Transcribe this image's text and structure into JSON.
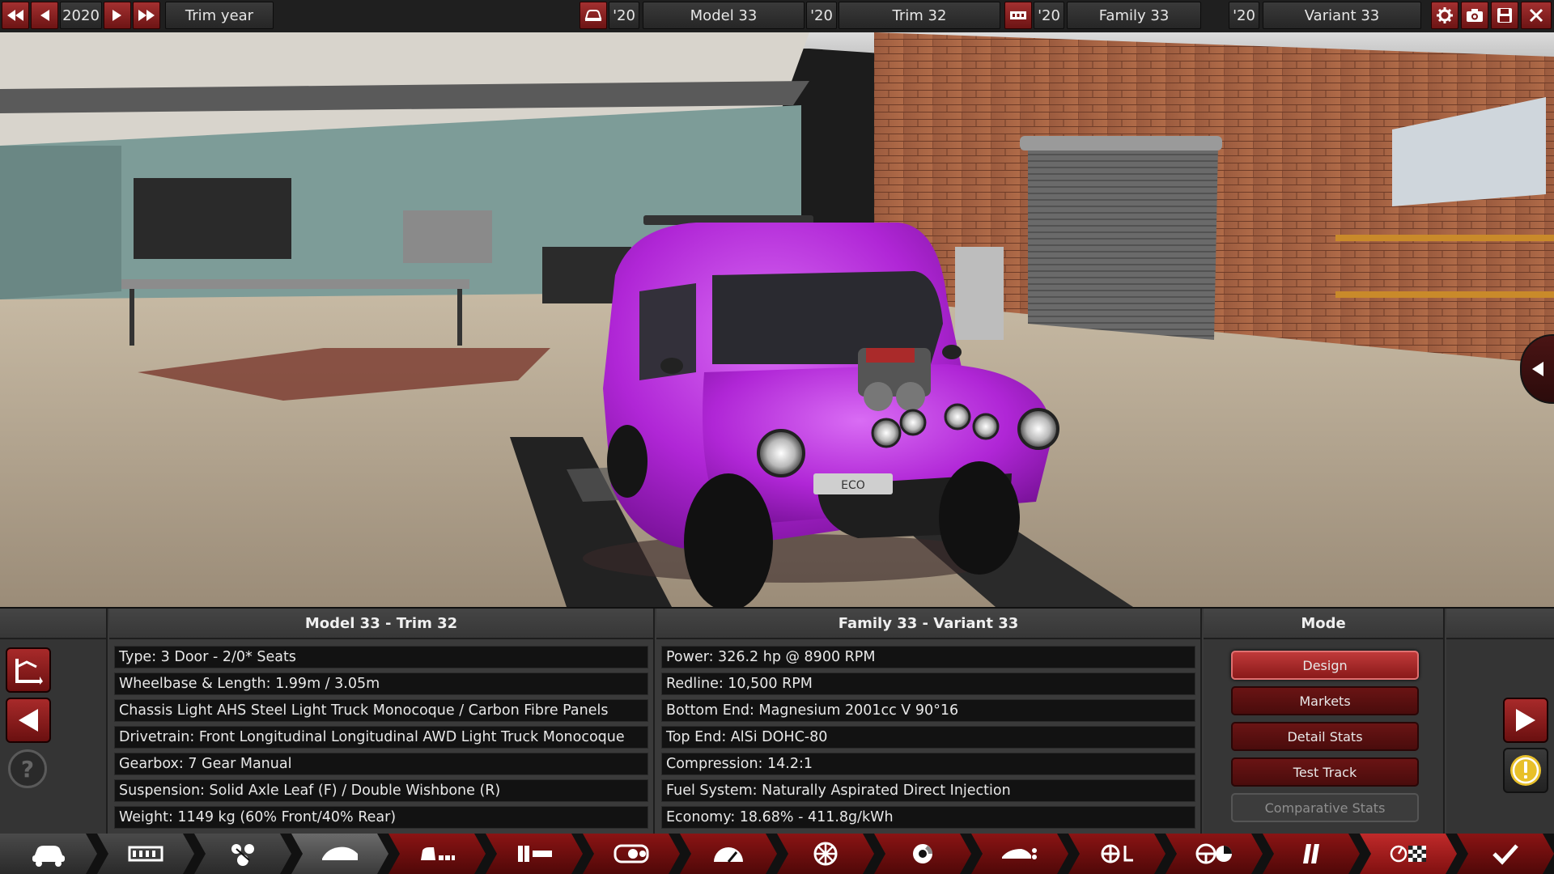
{
  "topbar": {
    "year": "2020",
    "trim_year_label": "Trim year",
    "model_year": "'20",
    "model_name": "Model 33",
    "trim_year": "'20",
    "trim_name": "Trim 32",
    "family_year": "'20",
    "family_name": "Family 33",
    "variant_year": "'20",
    "variant_name": "Variant 33"
  },
  "scene": {
    "plate_text": "ECO"
  },
  "left_panel": {
    "title": "Model 33 - Trim 32",
    "stats": [
      "Type: 3 Door - 2/0* Seats",
      "Wheelbase & Length: 1.99m / 3.05m",
      "Chassis Light AHS Steel Light Truck Monocoque / Carbon Fibre Panels",
      "Drivetrain: Front Longitudinal Longitudinal AWD Light Truck Monocoque",
      "Gearbox: 7 Gear Manual",
      "Suspension: Solid Axle Leaf (F) / Double Wishbone (R)",
      "Weight: 1149 kg (60% Front/40% Rear)"
    ]
  },
  "right_panel": {
    "title": "Family 33 - Variant 33",
    "stats": [
      "Power: 326.2 hp @ 8900 RPM",
      "Redline:  10,500 RPM",
      "Bottom End: Magnesium 2001cc V 90°16",
      "Top End: AlSi DOHC-80",
      "Compression: 14.2:1",
      "Fuel System: Naturally Aspirated Direct Injection",
      "Economy: 18.68% - 411.8g/kWh"
    ]
  },
  "mode": {
    "title": "Mode",
    "buttons": [
      "Design",
      "Markets",
      "Detail Stats",
      "Test Track",
      "Comparative Stats"
    ]
  },
  "colors": {
    "accent_red": "#8a1a1a",
    "car_paint": "#b026d6",
    "warning_yellow": "#e8c02a"
  },
  "icons": {
    "nav": [
      "car-icon",
      "chassis-icon",
      "engine-parts-icon",
      "body-icon",
      "fixtures-icon",
      "trim-icon",
      "engine-icon",
      "gauge-icon",
      "wheel-icon",
      "brake-icon",
      "aero-icon",
      "suspension-icon",
      "steering-icon",
      "tuning-icon",
      "test-flag-icon",
      "confirm-icon"
    ]
  }
}
